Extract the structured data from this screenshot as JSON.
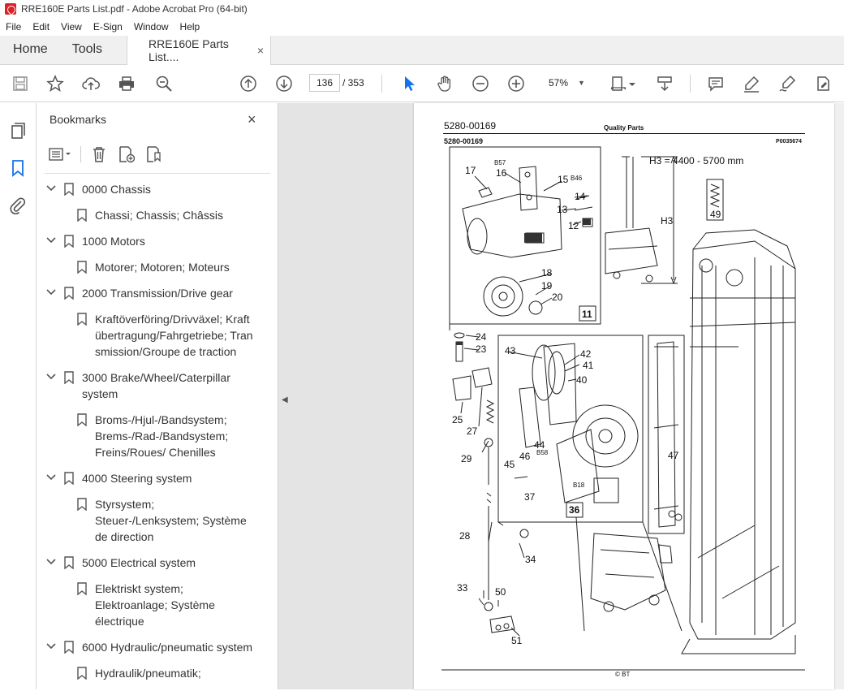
{
  "window": {
    "title": "RRE160E Parts List.pdf - Adobe Acrobat Pro (64-bit)"
  },
  "menu": [
    "File",
    "Edit",
    "View",
    "E-Sign",
    "Window",
    "Help"
  ],
  "tabs": {
    "home": "Home",
    "tools": "Tools",
    "document": "RRE160E Parts List....",
    "close": "×"
  },
  "toolbar": {
    "page_current": "136",
    "page_total": "/  353",
    "zoom": "57%"
  },
  "bookmarks": {
    "title": "Bookmarks",
    "close": "×",
    "items": [
      {
        "label": "0000 Chassis",
        "level": 0
      },
      {
        "label": "Chassi; Chassis; Châssis",
        "level": 1
      },
      {
        "label": "1000 Motors",
        "level": 0
      },
      {
        "label": "Motorer; Motoren; Moteurs",
        "level": 1
      },
      {
        "label": "2000 Transmission/Drive gear",
        "level": 0
      },
      {
        "label": "Kraftöverföring/Drivväxel; Kraftübertragung/Fahrgetriebe; Transmission/Groupe de traction",
        "level": 1
      },
      {
        "label": "3000 Brake/Wheel/Caterpillar system",
        "level": 0
      },
      {
        "label": "Broms-/Hjul-/Bandsystem; Brems-/Rad-/Bandsystem; Freins/Roues/ Chenilles",
        "level": 1
      },
      {
        "label": "4000 Steering system",
        "level": 0
      },
      {
        "label": "Styrsystem; Steuer-/Lenksystem; Système de direction",
        "level": 1
      },
      {
        "label": "5000 Electrical system",
        "level": 0
      },
      {
        "label": "Elektriskt system; Elektroanlage; Système électrique",
        "level": 1
      },
      {
        "label": "6000 Hydraulic/pneumatic system",
        "level": 0
      },
      {
        "label": "Hydraulik/pneumatik;",
        "level": 1
      }
    ]
  },
  "pdf_page": {
    "doc_number": "5280-00169",
    "header_center": "Quality Parts",
    "sub_number": "5280-00169",
    "figure_ref": "P0035674",
    "h3_label": "H3 = 4400 - 5700 mm",
    "h3": "H3",
    "footer": "© BT",
    "callouts": [
      "17",
      "16",
      "15",
      "14",
      "13",
      "12",
      "18",
      "19",
      "20",
      "11",
      "49",
      "24",
      "23",
      "43",
      "42",
      "41",
      "40",
      "44",
      "46",
      "45",
      "37",
      "36",
      "47",
      "25",
      "27",
      "29",
      "28",
      "34",
      "33",
      "50",
      "51"
    ],
    "small_callouts": [
      "B57",
      "B46",
      "B58",
      "B18"
    ]
  }
}
